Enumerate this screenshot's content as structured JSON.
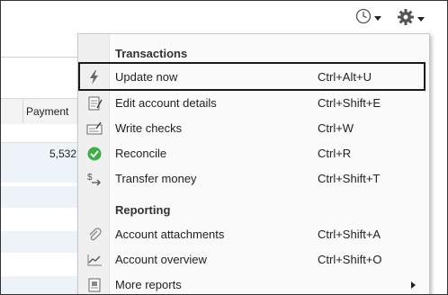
{
  "toolbar": {
    "icons": [
      "clock-icon",
      "gear-icon"
    ]
  },
  "background": {
    "column_header": "Payment",
    "row_value": "5,532"
  },
  "menu": {
    "sections": [
      {
        "title": "Transactions",
        "items": [
          {
            "label": "Update now",
            "shortcut": "Ctrl+Alt+U",
            "icon": "lightning-icon",
            "highlighted": true
          },
          {
            "label": "Edit account details",
            "shortcut": "Ctrl+Shift+E",
            "icon": "edit-document-icon"
          },
          {
            "label": "Write checks",
            "shortcut": "Ctrl+W",
            "icon": "check-icon"
          },
          {
            "label": "Reconcile",
            "shortcut": "Ctrl+R",
            "icon": "green-checkmark-icon"
          },
          {
            "label": "Transfer money",
            "shortcut": "Ctrl+Shift+T",
            "icon": "transfer-money-icon"
          }
        ]
      },
      {
        "title": "Reporting",
        "items": [
          {
            "label": "Account attachments",
            "shortcut": "Ctrl+Shift+A",
            "icon": "paperclip-icon"
          },
          {
            "label": "Account overview",
            "shortcut": "Ctrl+Shift+O",
            "icon": "line-chart-icon"
          },
          {
            "label": "More reports",
            "shortcut": "",
            "icon": "report-icon",
            "has_submenu": true
          }
        ]
      }
    ]
  },
  "colors": {
    "highlight_border": "#1a1a1a",
    "reconcile_green": "#3cb043",
    "row_stripe": "#eef3fa"
  }
}
